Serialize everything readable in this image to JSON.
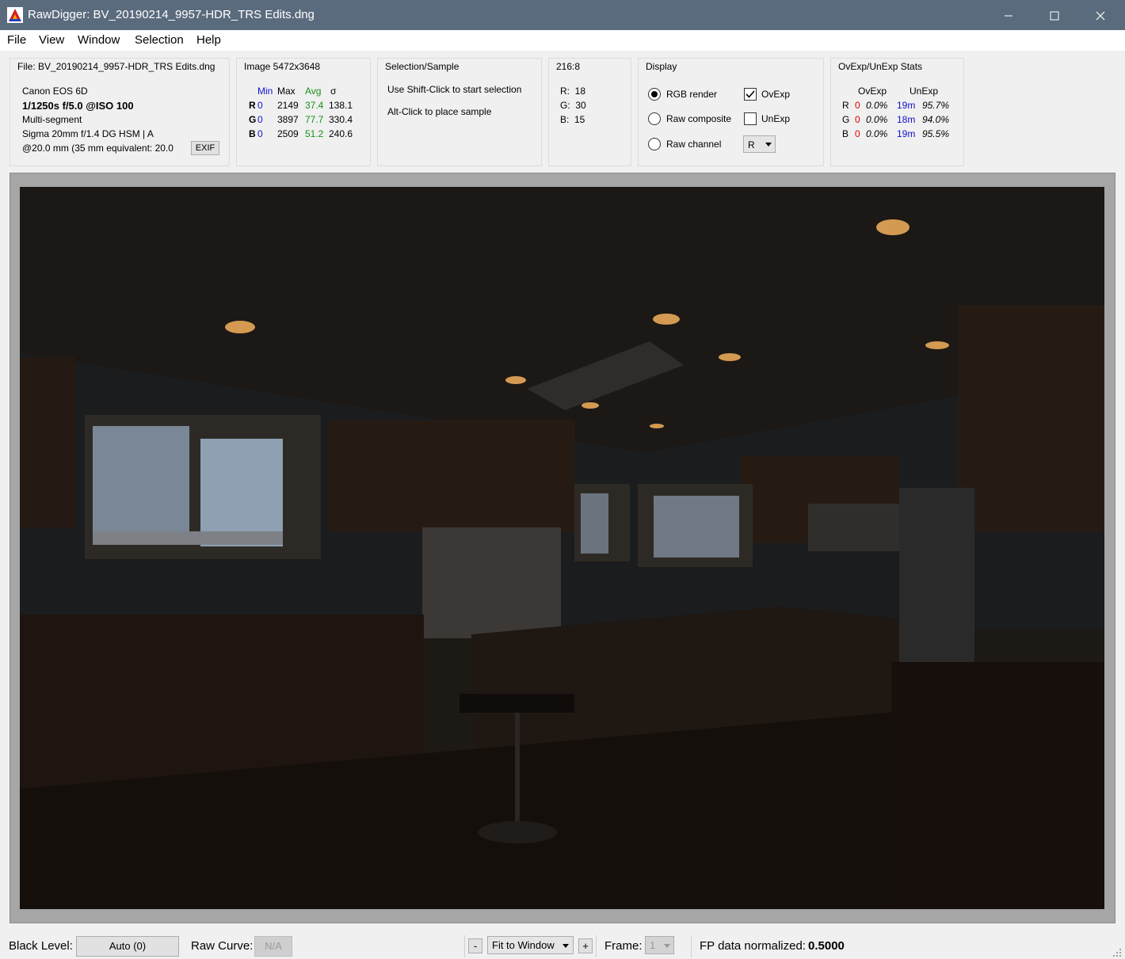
{
  "window": {
    "title": "RawDigger: BV_20190214_9957-HDR_TRS Edits.dng"
  },
  "menu": {
    "items": [
      {
        "label": "File"
      },
      {
        "label": "View"
      },
      {
        "label": "Window"
      },
      {
        "label": "Selection"
      },
      {
        "label": "Help"
      }
    ]
  },
  "file_panel": {
    "title": "File: BV_20190214_9957-HDR_TRS Edits.dng",
    "camera": "Canon EOS 6D",
    "exposure": "1/1250s f/5.0 @ISO 100",
    "metering": "Multi-segment",
    "lens": "Sigma 20mm f/1.4 DG HSM | A",
    "focal": "@20.0 mm (35 mm equivalent: 20.0",
    "exif_button": "EXIF"
  },
  "image_panel": {
    "title": "Image 5472x3648",
    "headers": {
      "min": "Min",
      "max": "Max",
      "avg": "Avg",
      "sigma": "σ"
    },
    "rows": [
      {
        "ch": "R",
        "min": "0",
        "max": "2149",
        "avg": "37.4",
        "sigma": "138.1"
      },
      {
        "ch": "G",
        "min": "0",
        "max": "3897",
        "avg": "77.7",
        "sigma": "330.4"
      },
      {
        "ch": "B",
        "min": "0",
        "max": "2509",
        "avg": "51.2",
        "sigma": "240.6"
      }
    ]
  },
  "selection_panel": {
    "title": "Selection/Sample",
    "line1": "Use Shift-Click to start selection",
    "line2": "Alt-Click to place sample"
  },
  "pixel_panel": {
    "title": "216:8",
    "r": "R:  18",
    "g": "G:  30",
    "b": "B:  15"
  },
  "display_panel": {
    "title": "Display",
    "rgb_render": "RGB render",
    "raw_composite": "Raw composite",
    "raw_channel": "Raw channel",
    "ovexp": "OvExp",
    "unexp": "UnExp",
    "channel_value": "R"
  },
  "stats_panel": {
    "title": "OvExp/UnExp Stats",
    "header_ovexp": "OvExp",
    "header_unexp": "UnExp",
    "rows": [
      {
        "ch": "R",
        "ov_count": "0",
        "ov_pct": "0.0%",
        "un_count": "19m",
        "un_pct": "95.7%"
      },
      {
        "ch": "G",
        "ov_count": "0",
        "ov_pct": "0.0%",
        "un_count": "18m",
        "un_pct": "94.0%"
      },
      {
        "ch": "B",
        "ov_count": "0",
        "ov_pct": "0.0%",
        "un_count": "19m",
        "un_pct": "95.5%"
      }
    ]
  },
  "statusbar": {
    "black_level_label": "Black Level:",
    "black_level_button": "Auto (0)",
    "raw_curve_label": "Raw Curve:",
    "raw_curve_button": "N/A",
    "zoom_minus": "-",
    "zoom_value": "Fit to Window",
    "zoom_plus": "+",
    "frame_label": "Frame:",
    "frame_value": "1",
    "fp_label": "FP data normalized:",
    "fp_value": "0.5000"
  }
}
